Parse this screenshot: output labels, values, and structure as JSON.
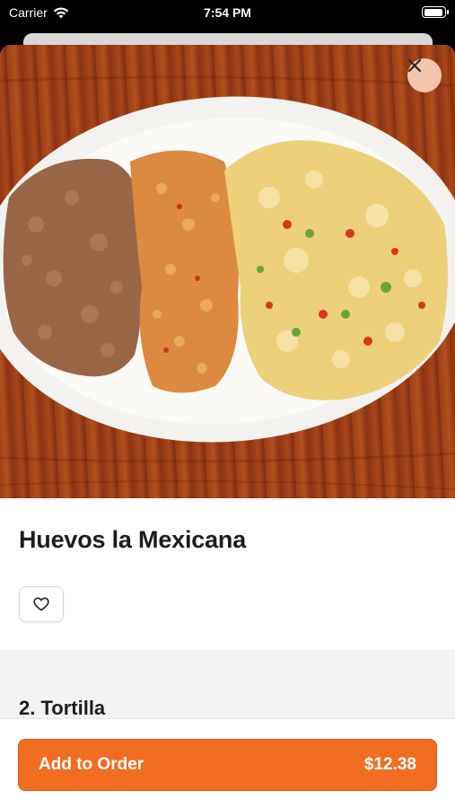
{
  "status": {
    "carrier": "Carrier",
    "time": "7:54 PM"
  },
  "item": {
    "name": "Huevos la Mexicana",
    "image_alt": "Plate with refried beans, rice and scrambled eggs"
  },
  "sections": [
    {
      "label": "2. Tortilla"
    }
  ],
  "footer": {
    "add_label": "Add to Order",
    "price": "$12.38"
  },
  "colors": {
    "accent": "#f06d22",
    "close_bg": "#f4c7ad"
  },
  "icons": {
    "close": "close-icon",
    "favorite": "heart-outline-icon",
    "wifi": "wifi-icon",
    "battery": "battery-icon"
  }
}
